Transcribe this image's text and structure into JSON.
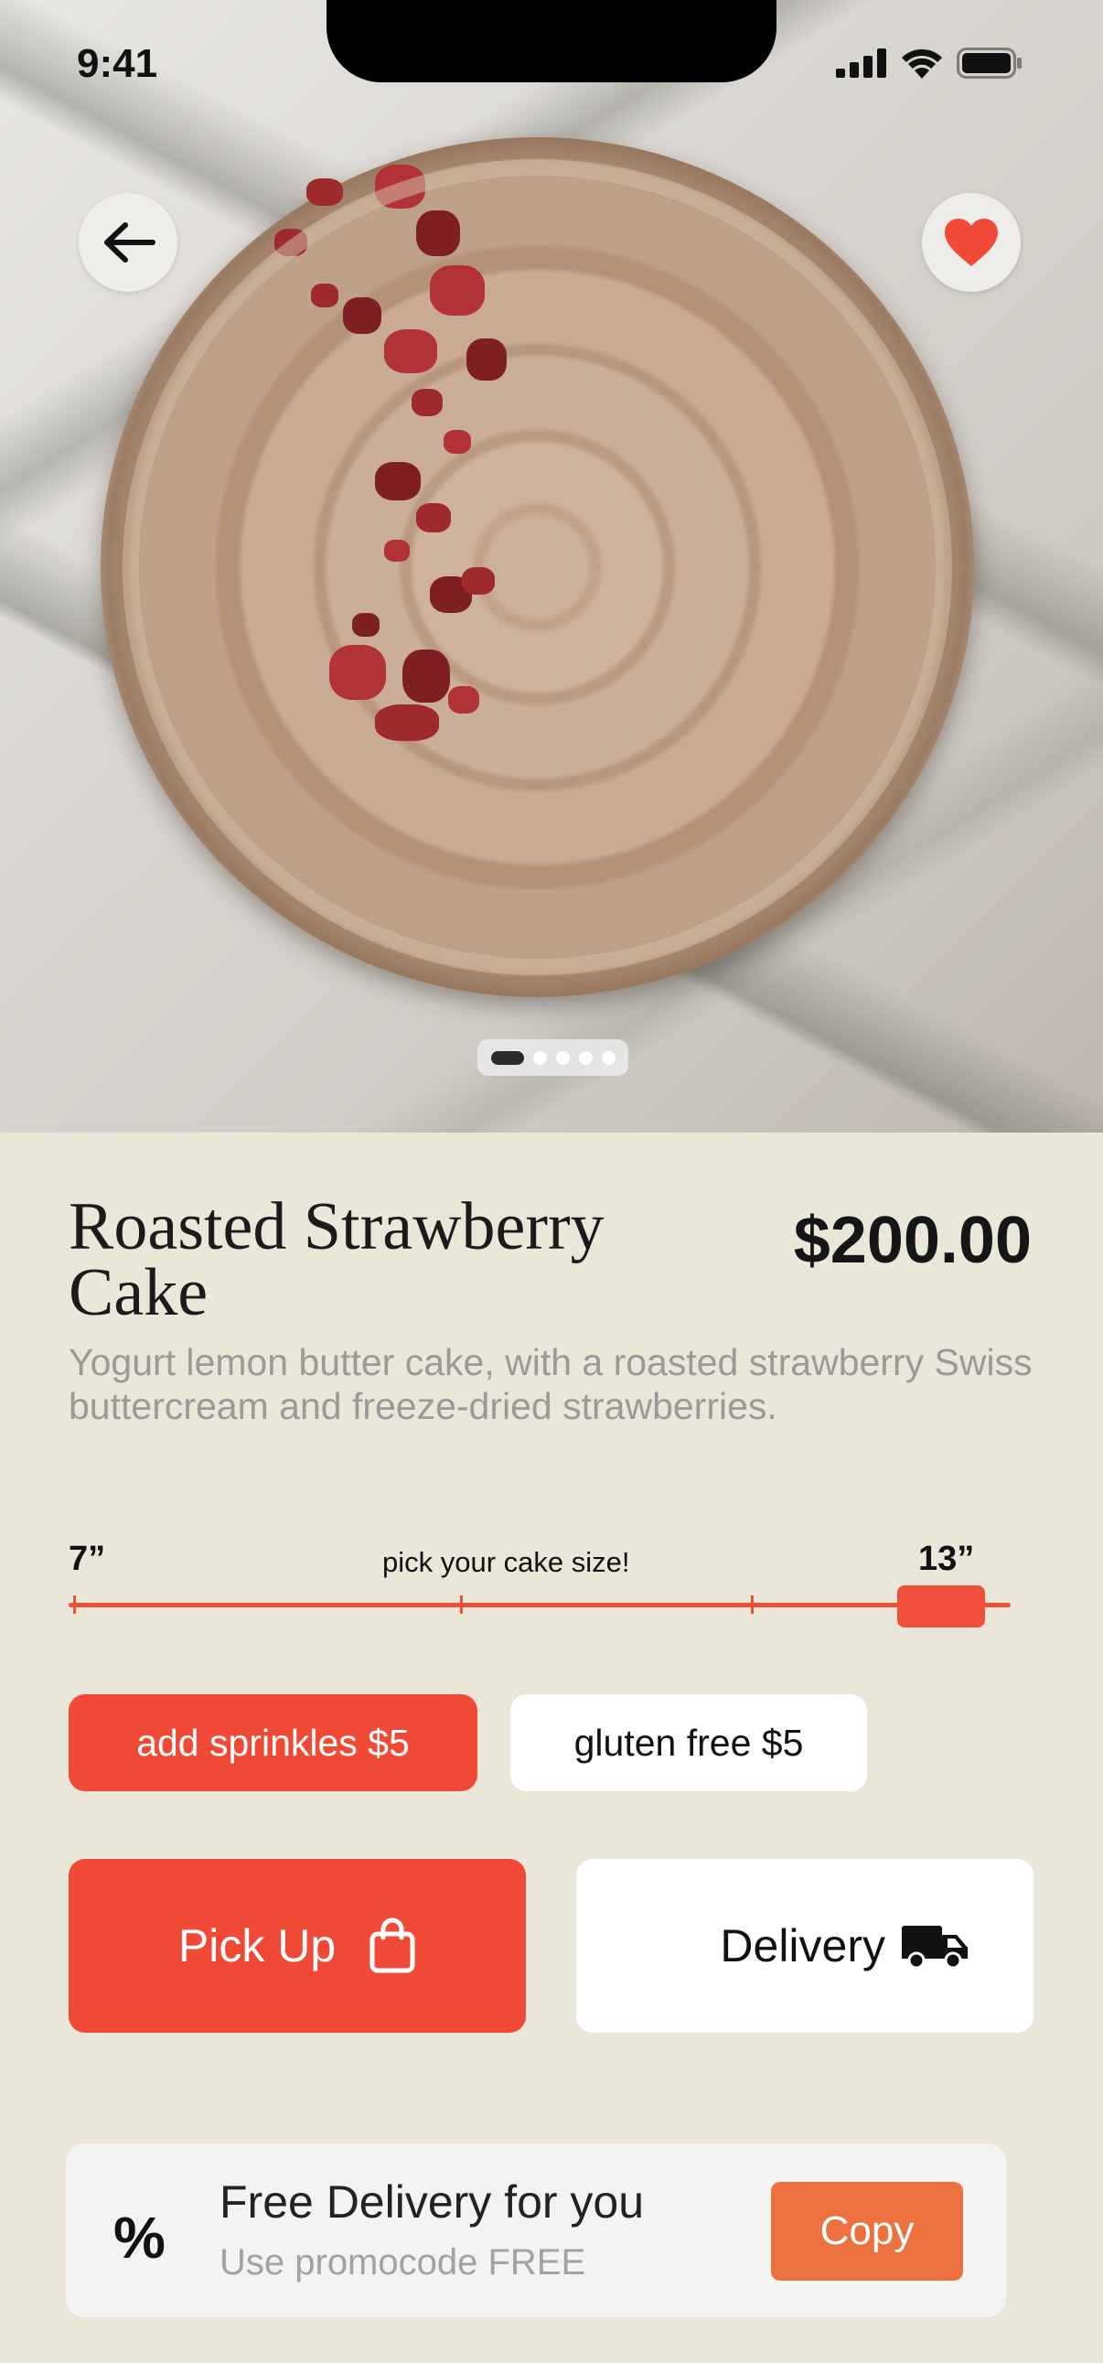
{
  "status_bar": {
    "time": "9:41"
  },
  "icons": {
    "back": "arrow-left-icon",
    "favorite": "heart-icon",
    "signal": "signal-icon",
    "wifi": "wifi-icon",
    "battery": "battery-icon",
    "bag": "shopping-bag-icon",
    "truck": "truck-icon",
    "percent": "percent-icon"
  },
  "gallery": {
    "current_page": 1,
    "total_pages": 5
  },
  "product": {
    "title": "Roasted Strawberry Cake",
    "price": "$200.00",
    "description": "Yogurt lemon butter cake, with a roasted strawberry Swiss buttercream and freeze-dried strawberries."
  },
  "size_picker": {
    "min_label": "7”",
    "max_label": "13”",
    "hint": "pick your cake size!",
    "selected_position": 0.94
  },
  "options": {
    "sprinkles": "add sprinkles $5",
    "gluten_free": "gluten free $5"
  },
  "fulfillment": {
    "pickup": "Pick Up",
    "delivery": "Delivery"
  },
  "promo": {
    "icon_text": "%",
    "title": "Free Delivery for you",
    "subtitle": "Use promocode FREE",
    "copy_label": "Copy"
  },
  "colors": {
    "accent": "#F04A36",
    "copy": "#EC713F",
    "background": "#EAE7D8",
    "heart": "#F04A36"
  }
}
